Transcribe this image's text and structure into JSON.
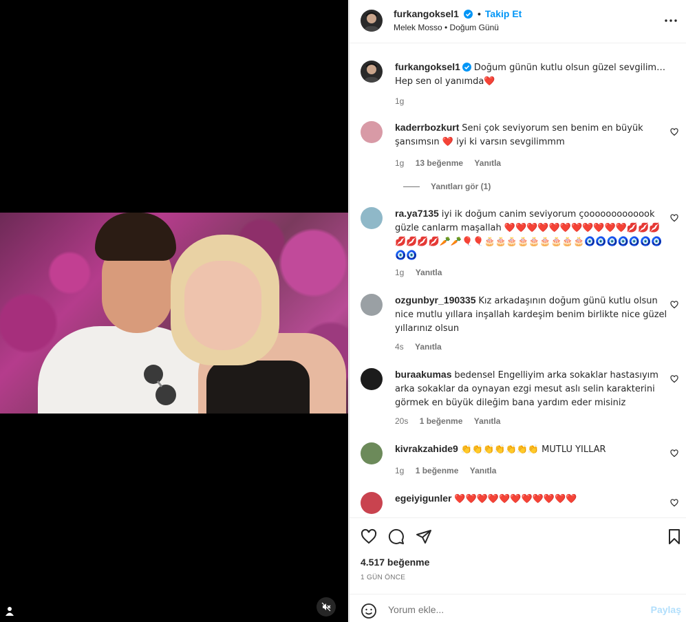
{
  "header": {
    "username": "furkangoksel1",
    "follow_label": "Takip Et",
    "sub": "Melek Mosso • Doğum Günü"
  },
  "caption": {
    "username": "furkangoksel1",
    "text": "Doğum günün kutlu olsun güzel sevgilim… Hep sen ol yanımda❤️",
    "time": "1g"
  },
  "comments": [
    {
      "username": "kaderrbozkurt",
      "text": "Seni çok seviyorum sen benim en büyük şansımsın ❤️ iyi ki varsın sevgilimmm",
      "time": "1g",
      "likes": "13 beğenme",
      "reply": "Yanıtla",
      "avatar_color": "#d89aa6"
    },
    {
      "username": "ra.ya7135",
      "text": "iyi ik doğum canim seviyorum çooooooooooook güzle canlarm maşallah ❤️❤️❤️❤️❤️❤️❤️❤️❤️❤️❤️💋💋💋💋💋💋💋🥕🥕🎈🎈🎂🎂🎂🎂🎂🎂🎂🎂🎂🧿🧿🧿🧿🧿🧿🧿🧿🧿",
      "time": "1g",
      "likes": "",
      "reply": "Yanıtla",
      "avatar_color": "#8fb8c8"
    },
    {
      "username": "ozgunbyr_190335",
      "text": "Kız arkadaşının doğum günü kutlu olsun nice mutlu yıllara inşallah kardeşim benim birlikte nice güzel yıllarınız olsun",
      "time": "4s",
      "likes": "",
      "reply": "Yanıtla",
      "avatar_color": "#9aa0a4"
    },
    {
      "username": "buraakumas",
      "text": "bedensel Engelliyim arka sokaklar hastasıyım arka sokaklar da oynayan ezgi mesut aslı selin karakterini görmek en büyük dileğim bana yardım eder misiniz",
      "time": "20s",
      "likes": "1 beğenme",
      "reply": "Yanıtla",
      "avatar_color": "#1c1c1c"
    },
    {
      "username": "kivrakzahide9",
      "text": "👏👏👏👏👏👏👏 MUTLU YILLAR",
      "time": "1g",
      "likes": "1 beğenme",
      "reply": "Yanıtla",
      "avatar_color": "#6c8a5a"
    },
    {
      "username": "egeiyigunler",
      "text": "❤️❤️❤️❤️❤️❤️❤️❤️❤️❤️❤️",
      "time": "",
      "likes": "",
      "reply": "",
      "avatar_color": "#c9434f"
    }
  ],
  "view_replies": "Yanıtları gör (1)",
  "footer": {
    "likes": "4.517 beğenme",
    "date": "1 GÜN ÖNCE"
  },
  "add_comment": {
    "placeholder": "Yorum ekle...",
    "post_label": "Paylaş"
  },
  "colors": {
    "accent": "#0095f6",
    "post_disabled": "#b2dffc",
    "heart": "#ed4956"
  }
}
